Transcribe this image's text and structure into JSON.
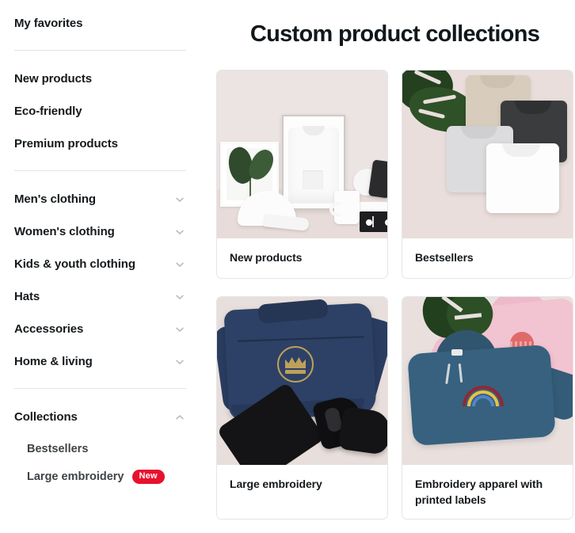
{
  "sidebar": {
    "favorites": {
      "label": "My favorites"
    },
    "quick_links": [
      {
        "label": "New products"
      },
      {
        "label": "Eco-friendly"
      },
      {
        "label": "Premium products"
      }
    ],
    "categories": [
      {
        "label": "Men's clothing",
        "icon": "chevron-down-icon",
        "expanded": false
      },
      {
        "label": "Women's clothing",
        "icon": "chevron-down-icon",
        "expanded": false
      },
      {
        "label": "Kids & youth clothing",
        "icon": "chevron-down-icon",
        "expanded": false
      },
      {
        "label": "Hats",
        "icon": "chevron-down-icon",
        "expanded": false
      },
      {
        "label": "Accessories",
        "icon": "chevron-down-icon",
        "expanded": false
      },
      {
        "label": "Home & living",
        "icon": "chevron-down-icon",
        "expanded": false
      }
    ],
    "collections": {
      "label": "Collections",
      "icon": "chevron-up-icon",
      "expanded": true,
      "items": [
        {
          "label": "Bestsellers",
          "badge": null
        },
        {
          "label": "Large embroidery",
          "badge": "New"
        }
      ]
    }
  },
  "main": {
    "title": "Custom product collections",
    "cards": [
      {
        "title": "New products"
      },
      {
        "title": "Bestsellers"
      },
      {
        "title": "Large embroidery"
      },
      {
        "title": "Embroidery apparel with printed labels"
      }
    ]
  },
  "colors": {
    "text": "#15191c",
    "subtext": "#3f4346",
    "badge": "#e8112d",
    "badge_text": "#ffffff",
    "card_border": "#e4e5e7",
    "divider": "#e2e3e5",
    "chevron": "#b9bcbe",
    "card_bg": "#ede5e3"
  }
}
